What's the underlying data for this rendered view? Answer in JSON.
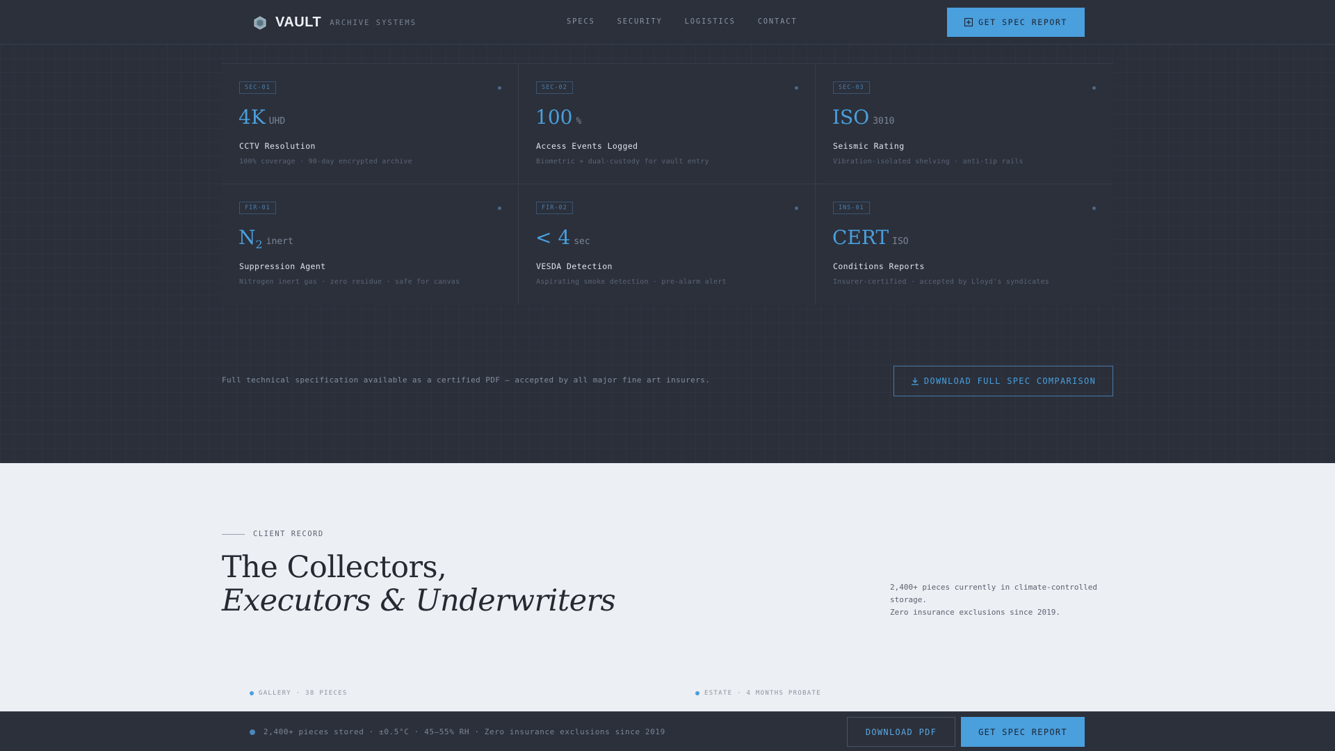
{
  "header": {
    "logo_text": "VAULT",
    "logo_sub": "ARCHIVE SYSTEMS",
    "nav": [
      "SPECS",
      "SECURITY",
      "LOGISTICS",
      "CONTACT"
    ],
    "cta_label": "GET SPEC REPORT"
  },
  "specs": [
    {
      "tag": "SEC-01",
      "value": "4K",
      "unit": "UHD",
      "title": "CCTV Resolution",
      "desc": "100% coverage · 90-day encrypted archive"
    },
    {
      "tag": "SEC-02",
      "value": "100",
      "unit": "%",
      "title": "Access Events Logged",
      "desc": "Biometric + dual-custody for vault entry"
    },
    {
      "tag": "SEC-03",
      "value": "ISO",
      "unit": "3010",
      "title": "Seismic Rating",
      "desc": "Vibration-isolated shelving · anti-tip rails"
    },
    {
      "tag": "FIR-01",
      "value": "N",
      "value_sub": "2",
      "unit": "inert",
      "title": "Suppression Agent",
      "desc": "Nitrogen inert gas · zero residue · safe for canvas"
    },
    {
      "tag": "FIR-02",
      "value": "< 4",
      "unit": "sec",
      "title": "VESDA Detection",
      "desc": "Aspirating smoke detection · pre-alarm alert"
    },
    {
      "tag": "INS-01",
      "value": "CERT",
      "unit": "ISO",
      "title": "Conditions Reports",
      "desc": "Insurer-certified · accepted by Lloyd's syndicates"
    }
  ],
  "spec_note": "Full technical specification available as a certified PDF — accepted by all major fine art insurers.",
  "download_full_label": "DOWNLOAD FULL SPEC COMPARISON",
  "client": {
    "eyebrow": "CLIENT RECORD",
    "headline_1": "The Collectors,",
    "headline_2": "Executors & Underwriters",
    "stats_1": "2,400+ pieces currently in climate-controlled storage.",
    "stats_2": "Zero insurance exclusions since 2019.",
    "categories": [
      "GALLERY · 38 PIECES",
      "ESTATE · 4 MONTHS PROBATE"
    ]
  },
  "bottom_bar": {
    "status": "2,400+ pieces stored · ±0.5°C · 45–55% RH · Zero insurance exclusions since 2019",
    "pdf_label": "DOWNLOAD PDF",
    "spec_label": "GET SPEC REPORT"
  },
  "colors": {
    "accent": "#4a9fdd",
    "dark_bg": "#2a2f3a",
    "light_bg": "#eceff3"
  }
}
